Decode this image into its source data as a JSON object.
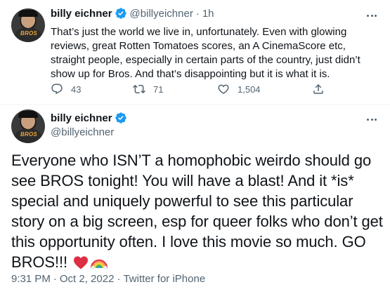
{
  "tweet1": {
    "display_name": "billy eichner",
    "handle": "@billyeichner",
    "separator": "·",
    "time": "1h",
    "text": "That’s just the world we live in, unfortunately. Even with glowing reviews, great Rotten Tomatoes scores, an A CinemaScore etc, straight people, especially in certain parts of the country, just didn’t show up for Bros. And that’s disappointing but it is what it is.",
    "replies": "43",
    "retweets": "71",
    "likes": "1,504"
  },
  "tweet2": {
    "display_name": "billy eichner",
    "handle": "@billyeichner",
    "text": "Everyone who ISN’T a homophobic weirdo should go see BROS tonight! You will have a blast! And it *is* special and uniquely powerful to see this particular story on a big screen, esp for queer folks who don’t get this opportunity often. I love this movie so much. GO BROS!!!",
    "time": "9:31 PM",
    "separator": "·",
    "date": "Oct 2, 2022",
    "separator2": "·",
    "source": "Twitter for iPhone"
  },
  "colors": {
    "verified_blue": "#1d9bf0",
    "secondary_text": "#536471",
    "primary_text": "#0f1419"
  },
  "avatar_logo_text": "BROS"
}
